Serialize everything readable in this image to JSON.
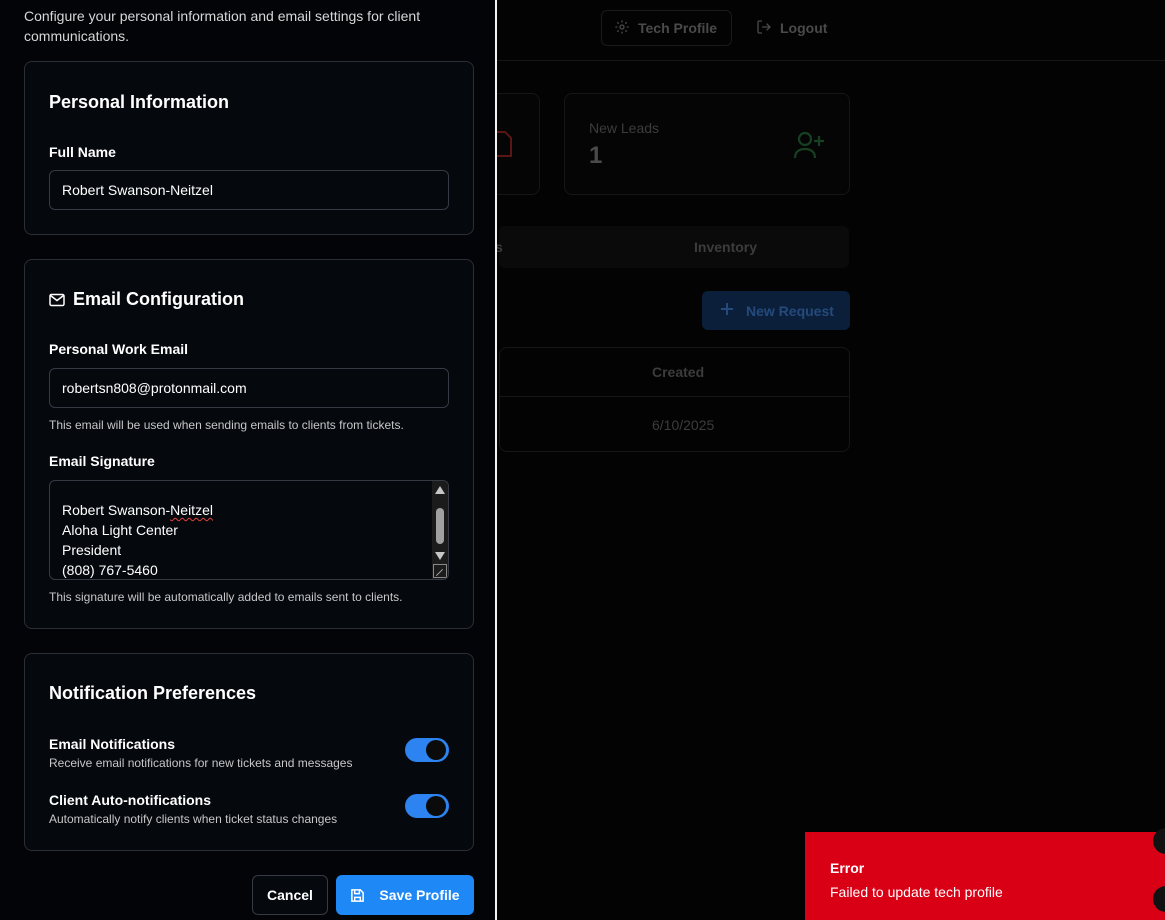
{
  "background": {
    "tech_profile_label": "Tech Profile",
    "logout_label": "Logout",
    "new_leads_label": "New Leads",
    "new_leads_count": "1",
    "tab_partial": "s",
    "tab_inventory": "Inventory",
    "new_request_label": "New Request",
    "table_header_created": "Created",
    "table_cell_created": "6/10/2025"
  },
  "drawer": {
    "description": "Configure your personal information and email settings for client communications.",
    "personal": {
      "title": "Personal Information",
      "full_name_label": "Full Name",
      "full_name_value": "Robert Swanson-Neitzel"
    },
    "email": {
      "title": "Email Configuration",
      "work_email_label": "Personal Work Email",
      "work_email_value": "robertsn808@protonmail.com",
      "work_email_hint": "This email will be used when sending emails to clients from tickets.",
      "signature_label": "Email Signature",
      "signature_first": "Robert Swanson-",
      "signature_first_flagged": "Neitzel",
      "signature_lines": [
        "Aloha Light Center",
        "President",
        "(808) 767-5460"
      ],
      "signature_hint": "This signature will be automatically added to emails sent to clients."
    },
    "notifications": {
      "title": "Notification Preferences",
      "email_title": "Email Notifications",
      "email_desc": "Receive email notifications for new tickets and messages",
      "email_enabled": true,
      "client_title": "Client Auto-notifications",
      "client_desc": "Automatically notify clients when ticket status changes",
      "client_enabled": true
    },
    "cancel_label": "Cancel",
    "save_label": "Save Profile"
  },
  "toast": {
    "title": "Error",
    "message": "Failed to update tech profile"
  }
}
